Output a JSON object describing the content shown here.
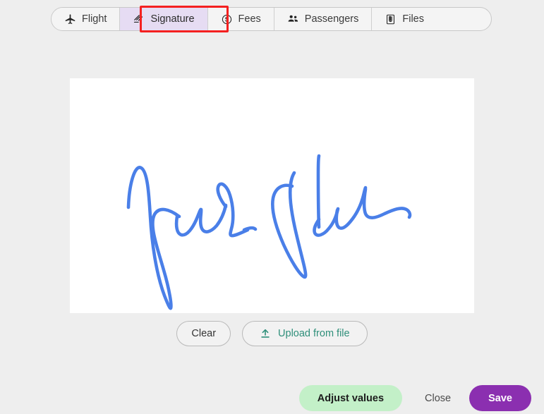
{
  "theme": {
    "page_background": "#eeeeee",
    "canvas_background": "#ffffff",
    "active_tab_background": "#e6dcf3",
    "annotation_outline": "#f42020",
    "signature_ink": "#4a7fe8",
    "upload_accent": "#2f8f7a",
    "save_accent": "#8b2fb0",
    "adjust_accent": "#c3f0c8"
  },
  "tabs": [
    {
      "id": "flight",
      "label": "Flight",
      "icon": "airplane-icon",
      "active": false
    },
    {
      "id": "signature",
      "label": "Signature",
      "icon": "signature-icon",
      "active": true
    },
    {
      "id": "fees",
      "label": "Fees",
      "icon": "dollar-circle-icon",
      "active": false
    },
    {
      "id": "passengers",
      "label": "Passengers",
      "icon": "passengers-icon",
      "active": false
    },
    {
      "id": "files",
      "label": "Files",
      "icon": "file-icon",
      "active": false
    }
  ],
  "signature_pad": {
    "ink_color": "#4a7fe8",
    "has_signature": true
  },
  "canvas_actions": {
    "clear_label": "Clear",
    "upload_label": "Upload from file",
    "upload_icon": "upload-icon"
  },
  "footer": {
    "adjust_label": "Adjust values",
    "close_label": "Close",
    "save_label": "Save"
  }
}
